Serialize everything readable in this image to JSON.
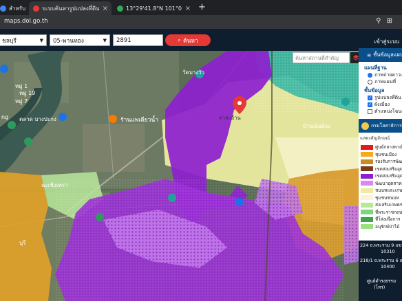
{
  "browser": {
    "tabs": [
      {
        "title": "สำหรับ บ้าน",
        "fav": "#4285f4"
      },
      {
        "title": "ระบบค้นหารูปแปลงที่ดิน (LandsMaps)",
        "fav": "#e53935"
      },
      {
        "title": "13°29'41.8\"N 101°04'11.1\"E - Goo",
        "fav": "#34a853"
      }
    ],
    "new_tab": "+",
    "close": "×",
    "url": "maps.dol.go.th"
  },
  "header": {
    "province": "ชลบุรี",
    "district": "05-พานทอง",
    "parcel_number": "2891",
    "search_label": "ค้นหา",
    "login_label": "เข้าสู่ระบบ"
  },
  "map": {
    "place_search_placeholder": "ค้นหาสถานที่สำคัญ",
    "labels": {
      "l1": "หมู่ 19",
      "l2": "หมู่ 7",
      "l3": "ตลาด บางปะกง",
      "l4": "ร้านแพเดียวน้ำ",
      "l5": "วัดบางวัว",
      "l6": "ฉะเชิงเทรา",
      "l7": "ท่าสะอ้าน",
      "l8": "บ้านเนินต้อง",
      "l9": "บุรี",
      "l10": "ng",
      "l11": "หมู่ 1"
    }
  },
  "panel": {
    "title": "ชั้นข้อมูลแผนที่",
    "basemap_heading": "แผนที่ฐาน",
    "basemaps": [
      {
        "label": "ภาพถ่ายดาวเทียม",
        "on": true
      },
      {
        "label": "ภาพแผนที่",
        "on": false
      }
    ],
    "layers_heading": "ชั้นข้อมูล",
    "layers": [
      {
        "label": "รูปแปลงที่ดิน",
        "on": true
      },
      {
        "label": "ผังเมือง",
        "on": true
      },
      {
        "label": "ตำแหน่งโฉนด",
        "on": false
      }
    ],
    "dept_name": "กรมโยธาธิการ",
    "legend_title": "แสดงสัญลักษณ์",
    "legend": [
      {
        "label": "ศูนย์กลางพาณิชยกรรม",
        "color": "#e01b1b"
      },
      {
        "label": "ชุมชนเมือง",
        "color": "#f7a81b"
      },
      {
        "label": "รองรับการพัฒนา",
        "color": "#c88a2a"
      },
      {
        "label": "เขตส่งเสริมอุตสาหกรรม",
        "color": "#7a3b1a"
      },
      {
        "label": "เขตส่งเสริมอุตสาหกรรม",
        "color": "#8e1fcf"
      },
      {
        "label": "พัฒนาอุตสาหกรรม",
        "color": "#d889ef"
      },
      {
        "label": "ชนบทและเกษตรกรรม",
        "color": "#eceba0"
      },
      {
        "label": "ชุมชนชนบท",
        "color": "#f7f5d6"
      },
      {
        "label": "ส่งเสริมเกษตรกรรม",
        "color": "#b9e89a"
      },
      {
        "label": "ที่พระราชกฤษฎีกา",
        "color": "#7dd67a"
      },
      {
        "label": "ที่โล่งเพื่อการ",
        "color": "#3fa34d"
      },
      {
        "label": "อนุรักษ์ป่าไม้",
        "color": "#9be07d"
      }
    ],
    "address1": "224 ถ.พระราม 9 แขวง",
    "address1b": "10310",
    "address2": "218/1 ถ.พระราม 6 แขวง",
    "address2b": "10400",
    "contact": "ศูนย์ดำรงธรรม",
    "contact2": "(โทร)"
  }
}
